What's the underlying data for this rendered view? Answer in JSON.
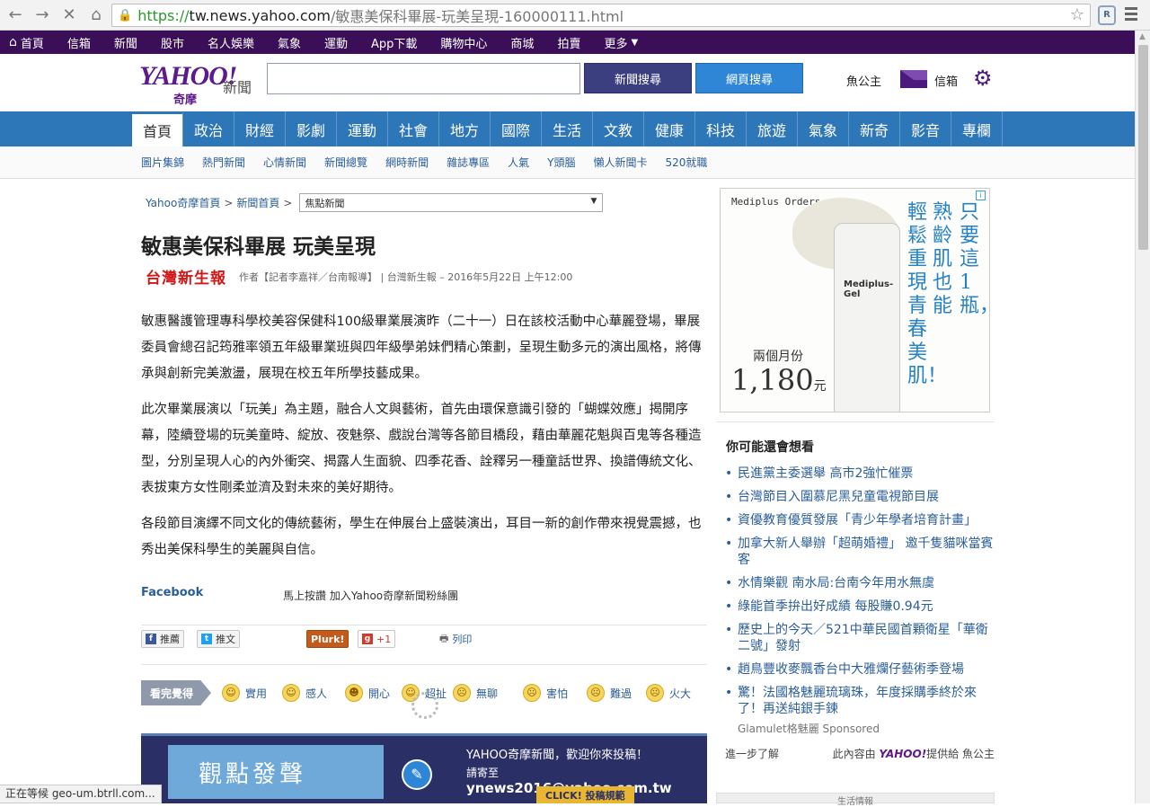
{
  "browser": {
    "url_scheme": "https://",
    "url_host": "tw.news.yahoo.com",
    "url_path": "/敏惠美保科畢展-玩美呈現-160000111.html",
    "status": "正在等候 geo-um.btrll.com..."
  },
  "topbar": {
    "items": [
      "首頁",
      "信箱",
      "新聞",
      "股市",
      "名人娛樂",
      "氣象",
      "運動",
      "App下載",
      "購物中心",
      "商城",
      "拍賣",
      "更多"
    ]
  },
  "header": {
    "logo": "YAHOO!",
    "logo_sub": "奇摩",
    "section": "新聞",
    "news_search": "新聞搜尋",
    "web_search": "網頁搜尋",
    "user": "魚公主",
    "mail": "信箱"
  },
  "categories": [
    "首頁",
    "政治",
    "財經",
    "影劇",
    "運動",
    "社會",
    "地方",
    "國際",
    "生活",
    "文教",
    "健康",
    "科技",
    "旅遊",
    "氣象",
    "新奇",
    "影音",
    "專欄"
  ],
  "subnav": [
    "圖片集錦",
    "熱門新聞",
    "心情新聞",
    "新聞總覽",
    "網時新聞",
    "雜誌專區",
    "人氣",
    "Y頭腦",
    "懶人新聞卡",
    "520就職"
  ],
  "article": {
    "breadcrumb": [
      "Yahoo奇摩首頁",
      "新聞首頁"
    ],
    "section_select": "焦點新聞",
    "title": "敏惠美保科畢展 玩美呈現",
    "source_logo": "台灣新生報",
    "byline": "作者【記者李嘉祥／台南報導】 | 台灣新生報 – 2016年5月22日 上午12:00",
    "paragraphs": [
      "敏惠醫護管理專科學校美容保健科100級畢業展演昨（二十一）日在該校活動中心華麗登場，畢展委員會總召記筠雅率領五年級畢業班與四年級學弟妹們精心策劃，呈現生動多元的演出風格，將傳承與創新完美激盪，展現在校五年所學技藝成果。",
      "此次畢業展演以「玩美」為主題，融合人文與藝術，首先由環保意識引發的「蝴蝶效應」揭開序幕，陸續登場的玩美童時、綻放、夜魅祭、戲說台灣等各節目橋段，藉由華麗花魁與百鬼等各種造型，分別呈現人心的內外衝突、揭露人生面貌、四季花香、詮釋另一種童話世界、換譜傳統文化、表拔東方女性剛柔並濟及對未來的美好期待。",
      "各段節目演繹不同文化的傳統藝術，學生在伸展台上盛裝演出，耳目一新的創作帶來視覺震撼，也秀出美保科學生的美麗與自信。"
    ],
    "facebook_label": "Facebook",
    "facebook_text": "馬上按讚 加入Yahoo奇摩新聞粉絲團",
    "share": {
      "like": "推薦",
      "tweet": "推文",
      "plurk": "Plurk!",
      "gplus": "+1",
      "print": "列印"
    },
    "reaction_label": "看完覺得",
    "reactions": [
      "實用",
      "感人",
      "開心",
      "超扯",
      "無聊",
      "害怕",
      "難過",
      "火大"
    ]
  },
  "banner": {
    "left_text": "觀點發聲",
    "line1": "YAHOO奇摩新聞，歡迎你來投稿！",
    "line2_prefix": "請寄至",
    "email": "ynews2016@yahoo.com.tw",
    "cta": "CLICK! 投稿規範"
  },
  "ad": {
    "brand": "Mediplus Orders",
    "bottle_label": "Mediplus-Gel",
    "vertical": [
      "只要這1瓶，",
      "熟齡肌也能",
      "輕鬆重現青春美肌！"
    ],
    "price_label": "兩個月份",
    "price": "1,180",
    "unit": "元"
  },
  "related": {
    "title": "你可能還會想看",
    "items": [
      "民進黨主委選舉 高市2強忙催票",
      "台灣節目入圍慕尼黑兒童電視節目展",
      "資優教育優質發展「青少年學者培育計畫」",
      "加拿大新人舉辦「超萌婚禮」 邀千隻貓咪當賓客",
      "水情樂觀 南水局:台南今年用水無虞",
      "綠能首季拚出好成績 每股賺0.94元",
      "歷史上的今天／521中華民國首顆衛星「華衛二號」發射",
      "趙鳥豐收麥飄香台中大雅爛仔藝術季登場",
      "驚！法國格魅麗琉璃珠，年度採購季終於來了！再送純銀手鍊"
    ],
    "sponsor": "Glamulet格魅麗 Sponsored",
    "learn_more": "進一步了解",
    "provided_by_prefix": "此內容由",
    "provided_by_logo": "YAHOO!",
    "provided_by_suffix": "提供給 魚公主"
  },
  "bottom_box": "生活情報"
}
